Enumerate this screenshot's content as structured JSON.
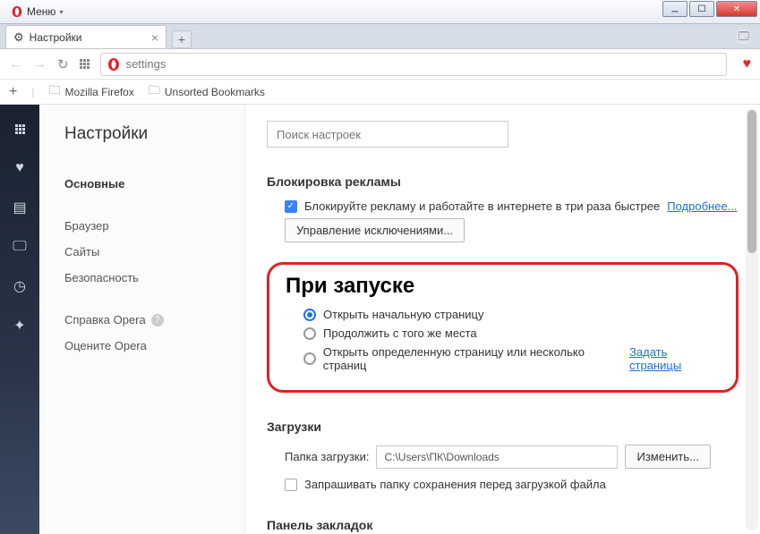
{
  "window": {
    "menu_label": "Меню"
  },
  "tab": {
    "title": "Настройки"
  },
  "addressbar": {
    "value": "settings"
  },
  "bookmarks": {
    "items": [
      "Mozilla Firefox",
      "Unsorted Bookmarks"
    ]
  },
  "sidebar": {
    "title": "Настройки",
    "items": [
      {
        "label": "Основные",
        "active": true
      },
      {
        "label": "Браузер"
      },
      {
        "label": "Сайты"
      },
      {
        "label": "Безопасность"
      }
    ],
    "help": "Справка Opera",
    "rate": "Оцените Opera"
  },
  "main": {
    "search_placeholder": "Поиск настроек",
    "adblock": {
      "title": "Блокировка рекламы",
      "checkbox_label": "Блокируйте рекламу и работайте в интернете в три раза быстрее",
      "learn_more": "Подробнее...",
      "manage_btn": "Управление исключениями..."
    },
    "startup": {
      "title": "При запуске",
      "opt1": "Открыть начальную страницу",
      "opt2": "Продолжить с того же места",
      "opt3": "Открыть определенную страницу или несколько страниц",
      "set_pages": "Задать страницы"
    },
    "downloads": {
      "title": "Загрузки",
      "folder_label": "Папка загрузки:",
      "folder_value": "C:\\Users\\ПК\\Downloads",
      "change_btn": "Изменить...",
      "ask_label": "Запрашивать папку сохранения перед загрузкой файла"
    },
    "bookmarks_panel": {
      "title": "Панель закладок"
    }
  }
}
